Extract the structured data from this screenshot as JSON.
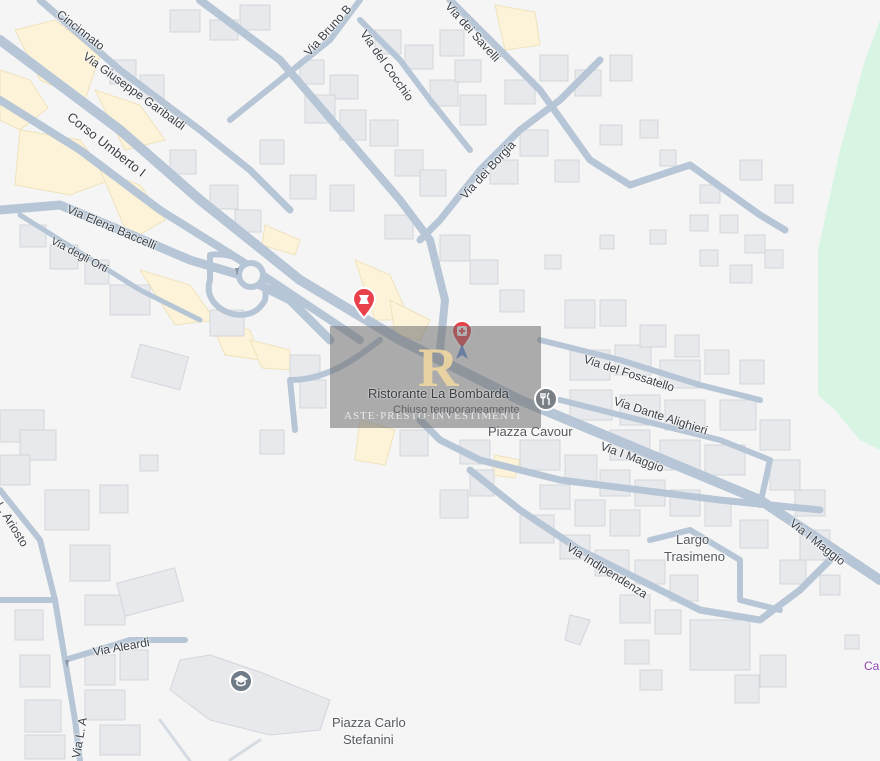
{
  "map": {
    "colors": {
      "background": "#f5f5f5",
      "road": "#b7c6d6",
      "building": "#e7e9ec",
      "building_stroke": "#d3d6da",
      "highlight_block": "#fdf3d8",
      "park": "#d8f5e4",
      "pin": "#e8414b",
      "poi_gray": "#757575"
    },
    "streets": [
      {
        "id": "cincinnato",
        "text": "Cincinnato"
      },
      {
        "id": "bruno",
        "text": "Via Bruno B"
      },
      {
        "id": "savelli",
        "text": "Via dei Savelli"
      },
      {
        "id": "cocchio",
        "text": "Via del Cocchio"
      },
      {
        "id": "garibaldi",
        "text": "Via Giuseppe Garibaldi"
      },
      {
        "id": "umberto",
        "text": "Corso Umberto I"
      },
      {
        "id": "borgia",
        "text": "Via dei Borgia"
      },
      {
        "id": "baccelli",
        "text": "Via Elena Baccelli"
      },
      {
        "id": "orti",
        "text": "Via degli Orti"
      },
      {
        "id": "fossatello",
        "text": "Via del Fossatello"
      },
      {
        "id": "dante",
        "text": "Via Dante Alighieri"
      },
      {
        "id": "maggio",
        "text": "Via I Maggio"
      },
      {
        "id": "maggio2",
        "text": "Via I Maggio"
      },
      {
        "id": "indipendenza",
        "text": "Via Indipendenza"
      },
      {
        "id": "ariosto",
        "text": "L. Ariosto"
      },
      {
        "id": "aleardi",
        "text": "Via Aleardi"
      },
      {
        "id": "via_l",
        "text": "Via L. A"
      }
    ],
    "places": [
      {
        "id": "cavour",
        "text": "Piazza Cavour"
      },
      {
        "id": "trasimeno",
        "line1": "Largo",
        "line2": "Trasimeno"
      },
      {
        "id": "stefanini",
        "line1": "Piazza Carlo",
        "line2": "Stefanini"
      },
      {
        "id": "edge",
        "text": "Ca"
      }
    ],
    "poi": {
      "name": "Ristorante La Bombarda",
      "status": "Chiuso temporaneamente"
    },
    "icons": [
      "museum-pin-icon",
      "medical-pin-icon",
      "restaurant-icon",
      "school-icon",
      "location-arrow-icon"
    ],
    "watermark": {
      "text": "ASTE·PRESTO·INVESTIMENTI",
      "logo": "R"
    }
  }
}
